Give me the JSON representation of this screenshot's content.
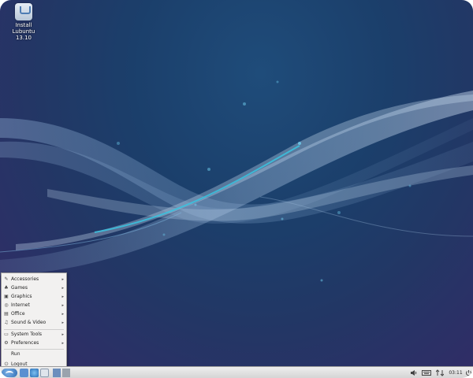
{
  "desktop": {
    "icon": {
      "label_line1": "Install",
      "label_line2": "Lubuntu 13.10"
    }
  },
  "menu": {
    "items": [
      {
        "label": "Accessories",
        "icon": "accessories-icon",
        "glyph": "✎",
        "submenu": true
      },
      {
        "label": "Games",
        "icon": "games-icon",
        "glyph": "♣",
        "submenu": true
      },
      {
        "label": "Graphics",
        "icon": "graphics-icon",
        "glyph": "▣",
        "submenu": true
      },
      {
        "label": "Internet",
        "icon": "internet-icon",
        "glyph": "◎",
        "submenu": true
      },
      {
        "label": "Office",
        "icon": "office-icon",
        "glyph": "▤",
        "submenu": true
      },
      {
        "label": "Sound & Video",
        "icon": "sound-video-icon",
        "glyph": "♫",
        "submenu": true
      },
      {
        "label": "System Tools",
        "icon": "system-tools-icon",
        "glyph": "▭",
        "submenu": true
      },
      {
        "label": "Preferences",
        "icon": "preferences-icon",
        "glyph": "⚙",
        "submenu": true
      },
      {
        "label": "Run",
        "icon": "run-icon",
        "glyph": "",
        "submenu": false
      },
      {
        "label": "Logout",
        "icon": "logout-icon",
        "glyph": "⏻",
        "submenu": false
      }
    ],
    "arrow_glyph": "▸"
  },
  "taskbar": {
    "clock": "03:11",
    "accent": "#3a7cc6"
  }
}
